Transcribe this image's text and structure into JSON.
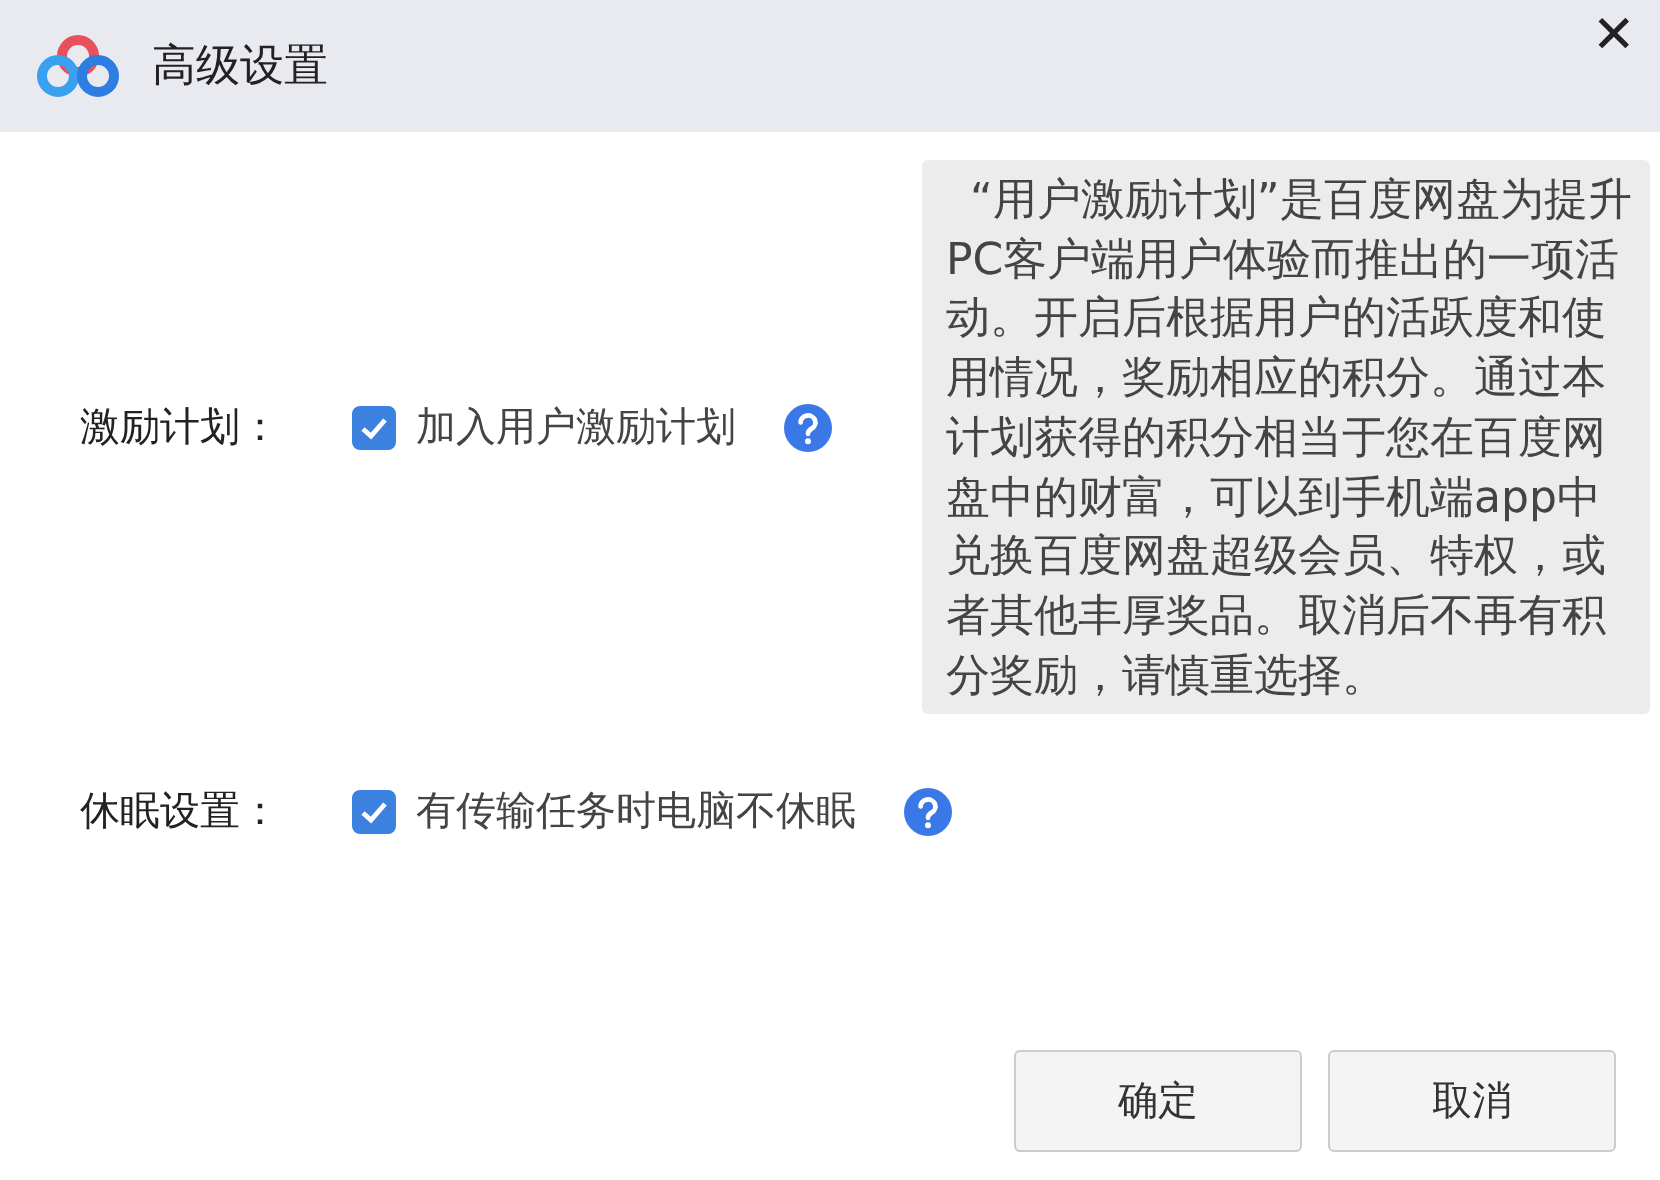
{
  "window": {
    "title": "高级设置",
    "close": "✕"
  },
  "settings": [
    {
      "label": "激励计划：",
      "option": "加入用户激励计划",
      "checked": true
    },
    {
      "label": "休眠设置：",
      "option": "有传输任务时电脑不休眠",
      "checked": true
    }
  ],
  "tooltip": {
    "text": "“用户激励计划”是百度网盘为提升PC客户端用户体验而推出的一项活动。开启后根据用户的活跃度和使用情况，奖励相应的积分。通过本计划获得的积分相当于您在百度网盘中的财富，可以到手机端app中兑换百度网盘超级会员、特权，或者其他丰厚奖品。取消后不再有积分奖励，请慎重选择。"
  },
  "buttons": [
    "确定",
    "取消"
  ]
}
